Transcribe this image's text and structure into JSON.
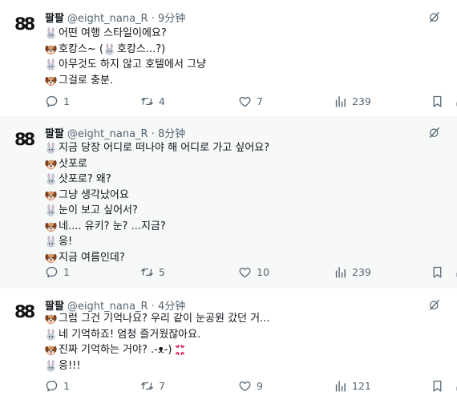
{
  "tweets": [
    {
      "name": "팔팔",
      "handle": "@eight_nana_R",
      "sep": "·",
      "time": "9分钟",
      "avatar": "88",
      "lines": [
        {
          "icon": "rabbit",
          "text": "어떤 여행 스타일이에요?"
        },
        {
          "icon": "dog",
          "text": "호캉스~ (",
          "inline_icon": "rabbit",
          "after": "호캉스...?)"
        },
        {
          "icon": "rabbit",
          "text": "아무것도 하지 않고 호텔에서 그냥"
        },
        {
          "icon": "dog",
          "text": "그걸로 충분."
        }
      ],
      "replies": "1",
      "retweets": "4",
      "likes": "7",
      "views": "239"
    },
    {
      "name": "팔팔",
      "handle": "@eight_nana_R",
      "sep": "·",
      "time": "8分钟",
      "avatar": "88",
      "lines": [
        {
          "icon": "rabbit",
          "text": "지금 당장 어디로 떠나야 해 어디로 가고 싶어요?"
        },
        {
          "icon": "dog",
          "text": "삿포로"
        },
        {
          "icon": "rabbit",
          "text": "삿포로? 왜?"
        },
        {
          "icon": "dog",
          "text": "그냥 생각났어요"
        },
        {
          "icon": "rabbit",
          "text": "눈이 보고 싶어서?"
        },
        {
          "icon": "dog",
          "text": "네.... 유키? 눈? ...지금?"
        },
        {
          "icon": "rabbit",
          "text": "응!"
        },
        {
          "icon": "dog",
          "text": "지금 여름인데?"
        }
      ],
      "replies": "1",
      "retweets": "5",
      "likes": "10",
      "views": "239"
    },
    {
      "name": "팔팔",
      "handle": "@eight_nana_R",
      "sep": "·",
      "time": "4分钟",
      "avatar": "88",
      "lines": [
        {
          "icon": "dog",
          "text": "그럼 그건 기억나요? 우리 같이 눈공원 갔던 거..."
        },
        {
          "icon": "rabbit",
          "text": "네 기억하죠! 엄청 즐거웠잖아요."
        },
        {
          "icon": "dog",
          "text": "진짜 기억하는 거야? .-ᴥ-)",
          "trailing_icon": "anger"
        },
        {
          "icon": "rabbit",
          "text": "응!!!"
        }
      ],
      "replies": "1",
      "retweets": "7",
      "likes": "9",
      "views": "121"
    }
  ]
}
